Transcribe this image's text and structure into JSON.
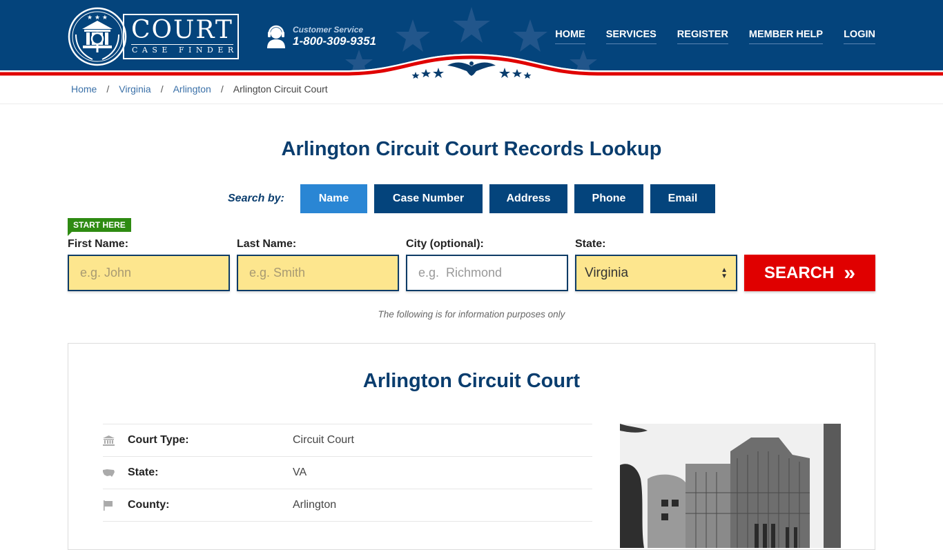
{
  "header": {
    "logo_title": "COURT",
    "logo_subtitle": "CASE FINDER",
    "customer_service_label": "Customer Service",
    "customer_service_phone": "1-800-309-9351",
    "nav": [
      {
        "label": "HOME"
      },
      {
        "label": "SERVICES"
      },
      {
        "label": "REGISTER"
      },
      {
        "label": "MEMBER HELP"
      },
      {
        "label": "LOGIN"
      }
    ]
  },
  "breadcrumb": {
    "items": [
      {
        "label": "Home"
      },
      {
        "label": "Virginia"
      },
      {
        "label": "Arlington"
      }
    ],
    "current": "Arlington Circuit Court",
    "separator": "/"
  },
  "page_title": "Arlington Circuit Court Records Lookup",
  "search": {
    "search_by_label": "Search by:",
    "tabs": [
      {
        "label": "Name",
        "active": true
      },
      {
        "label": "Case Number",
        "active": false
      },
      {
        "label": "Address",
        "active": false
      },
      {
        "label": "Phone",
        "active": false
      },
      {
        "label": "Email",
        "active": false
      }
    ],
    "start_here": "START HERE",
    "fields": {
      "first_name": {
        "label": "First Name:",
        "placeholder": "e.g. John",
        "value": ""
      },
      "last_name": {
        "label": "Last Name:",
        "placeholder": "e.g. Smith",
        "value": ""
      },
      "city": {
        "label": "City (optional):",
        "placeholder": "e.g.  Richmond",
        "value": ""
      },
      "state": {
        "label": "State:",
        "selected": "Virginia"
      }
    },
    "search_button": "SEARCH",
    "search_button_icon": "»",
    "disclaimer": "The following is for information purposes only"
  },
  "court": {
    "title": "Arlington Circuit Court",
    "details": [
      {
        "icon": "courthouse-icon",
        "label": "Court Type:",
        "value": "Circuit Court"
      },
      {
        "icon": "us-map-icon",
        "label": "State:",
        "value": "VA"
      },
      {
        "icon": "flag-icon",
        "label": "County:",
        "value": "Arlington"
      }
    ]
  },
  "colors": {
    "header_blue": "#04447c",
    "accent_red": "#e00000",
    "active_tab": "#2a86d4",
    "field_yellow": "#fde68e",
    "start_green": "#2e8b12"
  }
}
